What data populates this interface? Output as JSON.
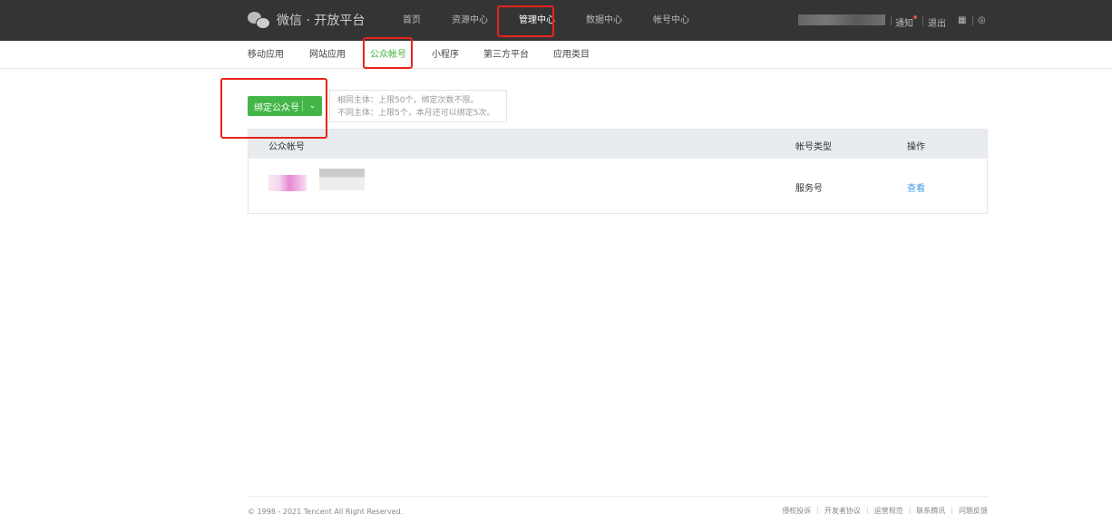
{
  "header": {
    "logo_text": "微信 · 开放平台",
    "nav": [
      "首页",
      "资源中心",
      "管理中心",
      "数据中心",
      "帐号中心"
    ],
    "active_nav": "管理中心",
    "notice": "通知",
    "logout": "退出"
  },
  "subnav": {
    "items": [
      "移动应用",
      "网站应用",
      "公众帐号",
      "小程序",
      "第三方平台",
      "应用类目"
    ],
    "active": "公众帐号"
  },
  "bind_button": {
    "label": "绑定公众号",
    "caret": "⌄"
  },
  "tip": {
    "line1": "相同主体：上限50个，绑定次数不限。",
    "line2": "不同主体：上限5个，本月还可以绑定5次。"
  },
  "table": {
    "headers": [
      "公众帐号",
      "帐号类型",
      "操作"
    ],
    "rows": [
      {
        "type": "服务号",
        "action": "查看"
      }
    ]
  },
  "footer": {
    "copyright": "© 1998 - 2021 Tencent All Right Reserved.",
    "links": [
      "侵权投诉",
      "开发者协议",
      "运营规范",
      "联系腾讯",
      "问题反馈"
    ]
  },
  "colors": {
    "accent": "#44b549",
    "header_bg": "#343434",
    "link": "#459ae9",
    "annotation": "#e8231d"
  }
}
